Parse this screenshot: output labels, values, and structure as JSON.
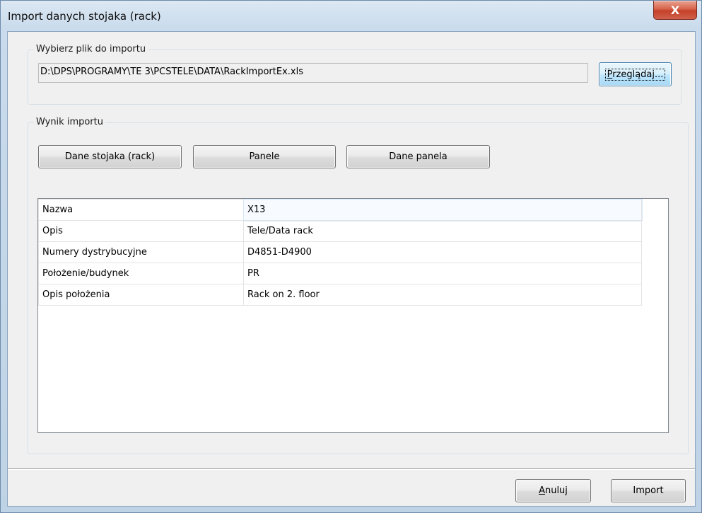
{
  "window": {
    "title": "Import danych stojaka (rack)",
    "close_glyph": "X"
  },
  "file_group": {
    "label": "Wybierz plik do importu",
    "path_value": "D:\\DPS\\PROGRAMY\\TE 3\\PCSTELE\\DATA\\RackImportEx.xls",
    "browse_label_accel": "P",
    "browse_label_rest": "rzeglądaj..."
  },
  "result_group": {
    "label": "Wynik importu",
    "tabs": [
      {
        "label": "Dane stojaka (rack)"
      },
      {
        "label": "Panele"
      },
      {
        "label": "Dane panela"
      }
    ],
    "rows": [
      {
        "key": "Nazwa",
        "value": "X13"
      },
      {
        "key": "Opis",
        "value": "Tele/Data rack"
      },
      {
        "key": "Numery dystrybucyjne",
        "value": "D4851-D4900"
      },
      {
        "key": "Położenie/budynek",
        "value": "PR"
      },
      {
        "key": "Opis położenia",
        "value": "Rack on 2. floor"
      }
    ]
  },
  "footer": {
    "cancel_accel": "A",
    "cancel_rest": "nuluj",
    "import_label": "Import"
  },
  "colors": {
    "title_bar": "#c9dbec",
    "close_button": "#c5412a",
    "dialog_bg": "#f0f0f0"
  }
}
